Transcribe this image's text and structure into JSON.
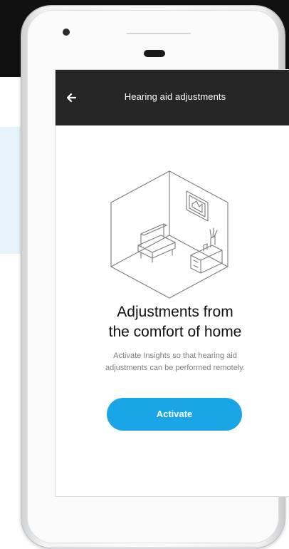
{
  "app": {
    "title": "Hearing aid adjustments"
  },
  "content": {
    "heading_line1": "Adjustments from",
    "heading_line2": "the comfort of home",
    "body_line1": "Activate Insights so that hearing aid",
    "body_line2": "adjustments can be performed remotely."
  },
  "actions": {
    "activate_label": "Activate"
  },
  "icons": {
    "back": "arrow-left-icon",
    "illustration": "room-illustration"
  },
  "colors": {
    "accent": "#1aa6e6",
    "appbar": "#262626",
    "background_dark": "#111111",
    "background_tint": "#e8f4fb"
  }
}
